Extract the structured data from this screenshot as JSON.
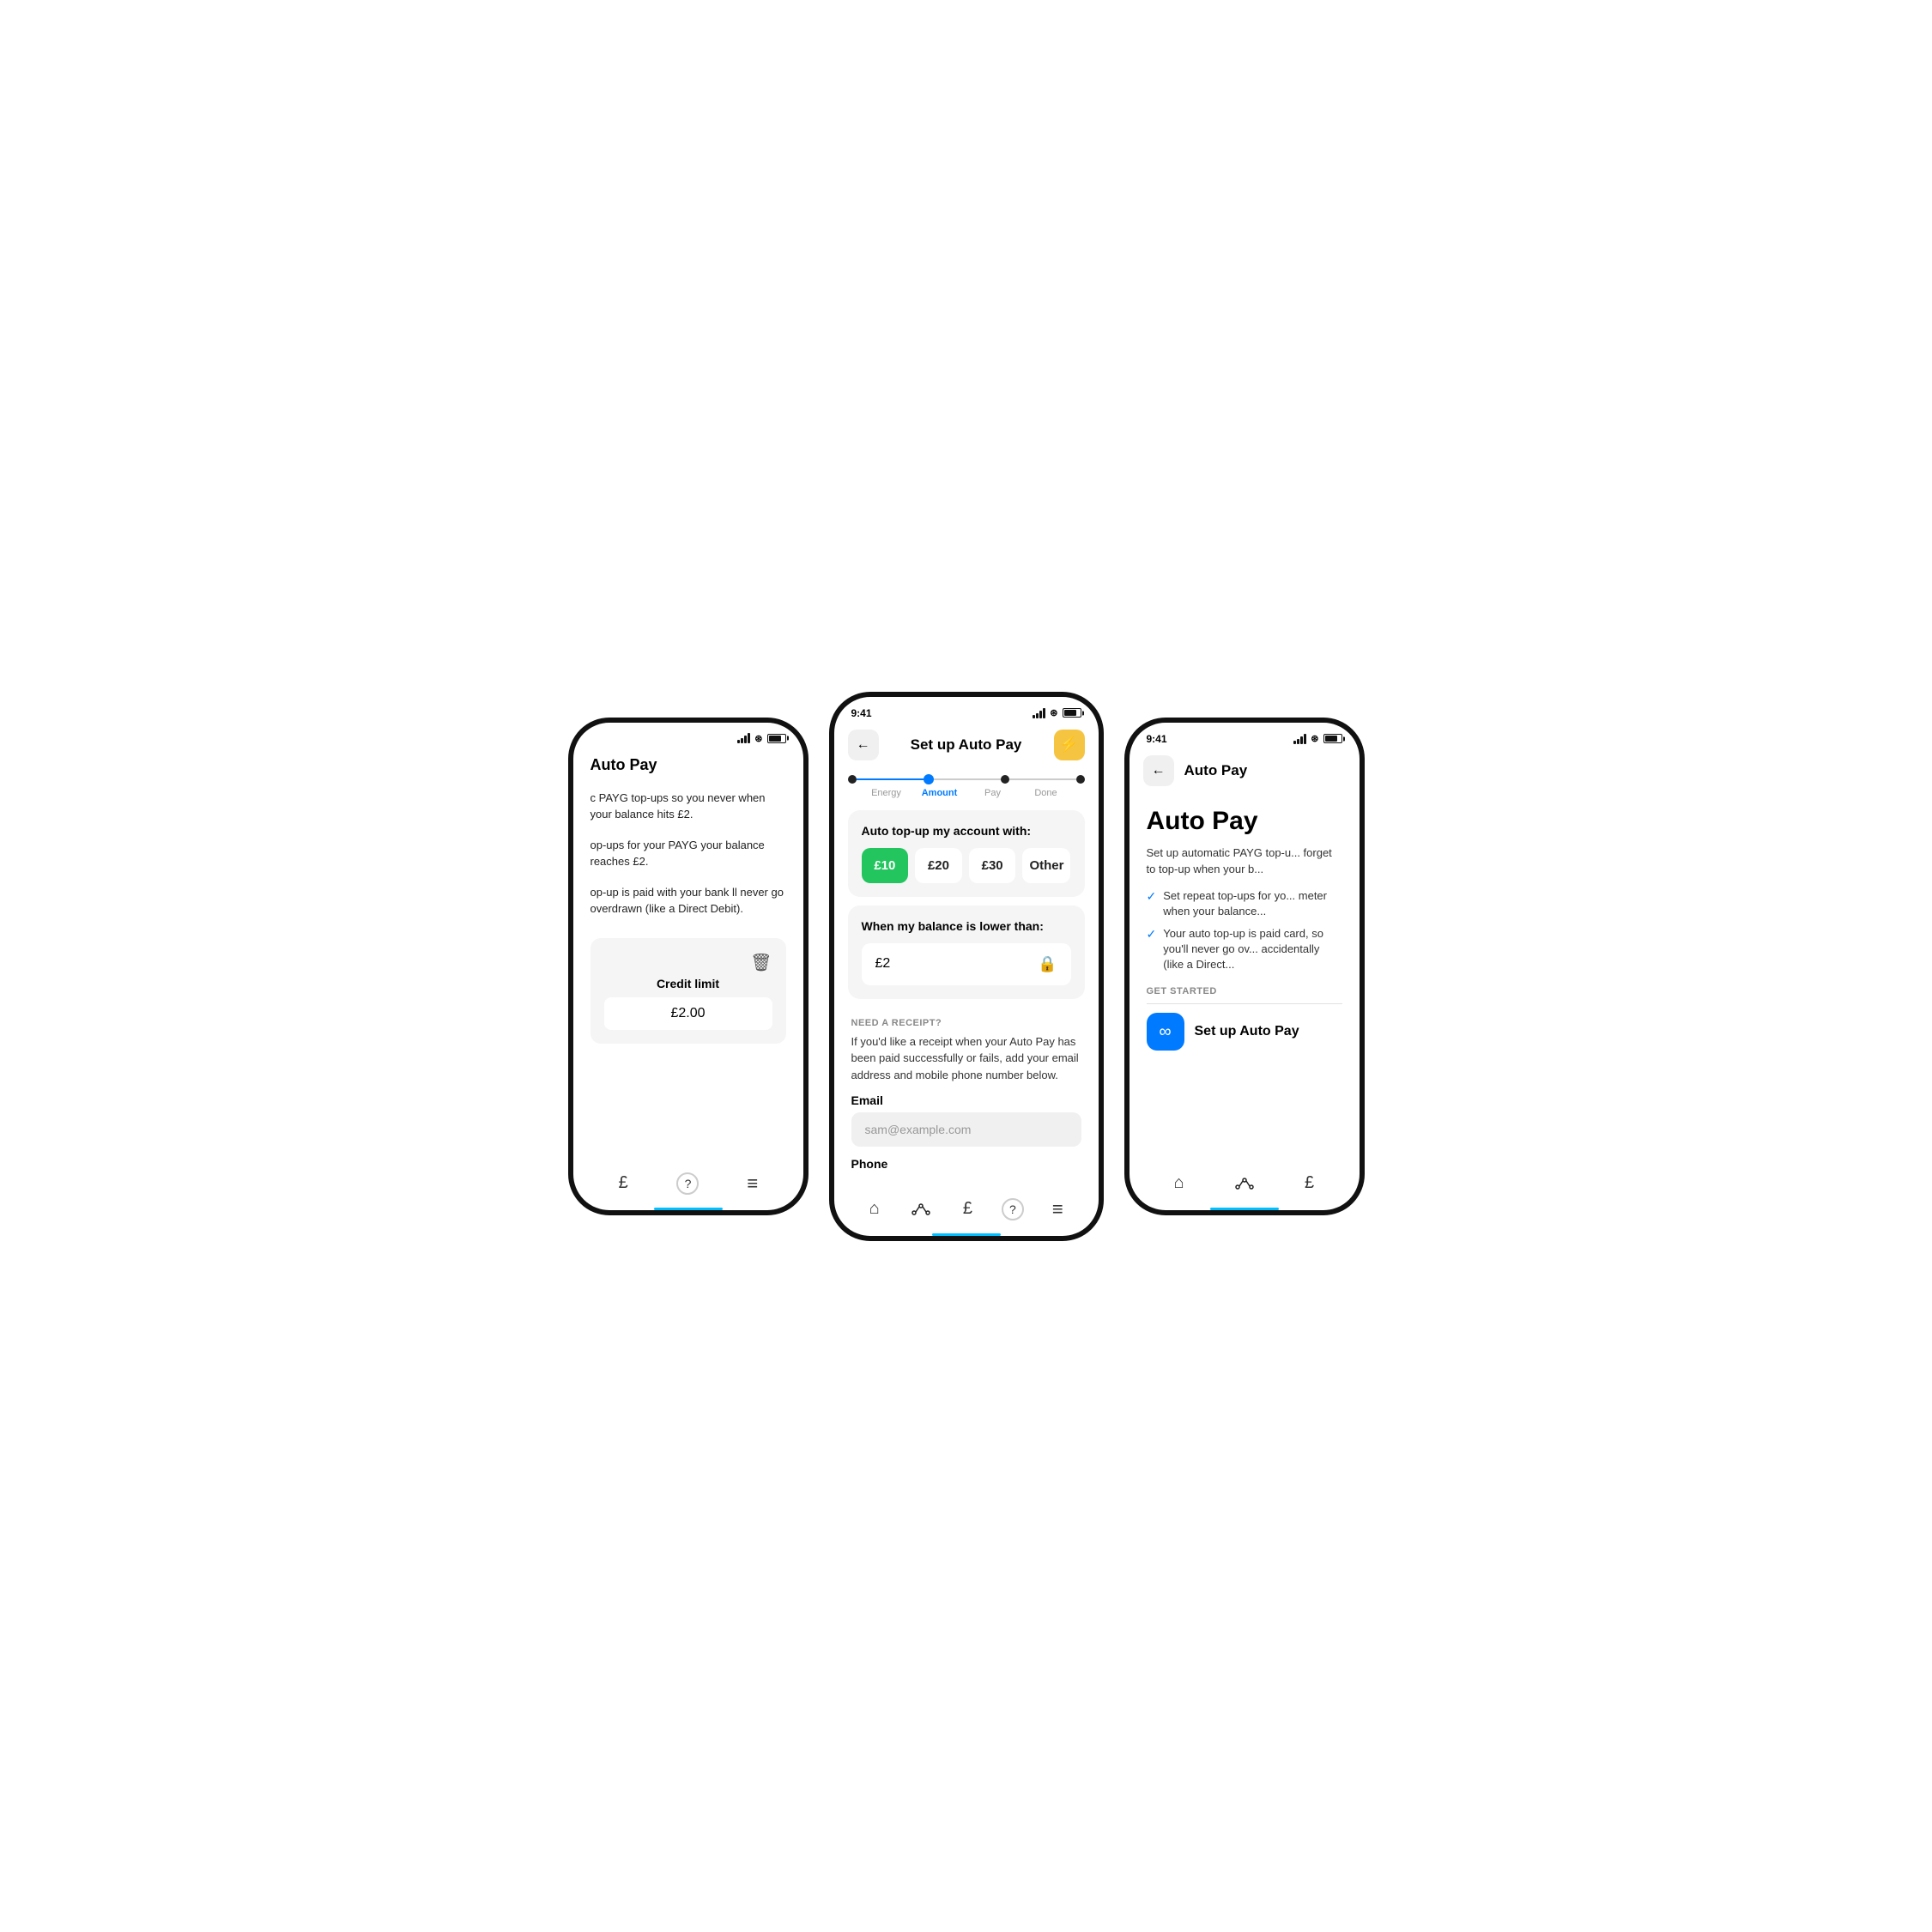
{
  "left_phone": {
    "title": "Auto Pay",
    "description1": "c PAYG top-ups so you never when your balance hits £2.",
    "description2": "op-ups for your PAYG your balance reaches £2.",
    "description3": "op-up is paid with your bank ll never go overdrawn (like a Direct Debit).",
    "credit_limit_label": "Credit limit",
    "credit_limit_value": "£2.00",
    "nav": {
      "items": [
        "£",
        "?",
        "≡"
      ]
    }
  },
  "center_phone": {
    "status_time": "9:41",
    "back_label": "←",
    "title": "Set up Auto Pay",
    "lightning_icon": "⚡",
    "steps": [
      {
        "label": "Energy",
        "active": false
      },
      {
        "label": "Amount",
        "active": true
      },
      {
        "label": "Pay",
        "active": false
      },
      {
        "label": "Done",
        "active": false
      }
    ],
    "amount_section": {
      "title": "Auto top-up my account with:",
      "options": [
        {
          "label": "£10",
          "selected": true
        },
        {
          "label": "£20",
          "selected": false
        },
        {
          "label": "£30",
          "selected": false
        },
        {
          "label": "Other",
          "selected": false
        }
      ]
    },
    "balance_section": {
      "title": "When my balance is lower than:",
      "value": "£2"
    },
    "receipt_section": {
      "label": "NEED A RECEIPT?",
      "description": "If you'd like a receipt when your Auto Pay has been paid successfully or fails, add your email address and mobile phone number below.",
      "email_label": "Email",
      "email_placeholder": "sam@example.com",
      "phone_label": "Phone"
    },
    "nav": {
      "items": [
        "⌂",
        "〰",
        "£",
        "?",
        "≡"
      ]
    }
  },
  "right_phone": {
    "status_time": "9:41",
    "back_label": "←",
    "title": "Auto Pay",
    "main_title": "Auto Pay",
    "description": "Set up automatic PAYG top-u... forget to top-up when your b...",
    "checks": [
      "Set repeat top-ups for yo... meter when your balance...",
      "Your auto top-up is paid card, so you'll never go ov... accidentally (like a Direct..."
    ],
    "get_started_label": "GET STARTED",
    "setup_btn_label": "Set up Auto Pay",
    "nav": {
      "items": [
        "⌂",
        "〰",
        "£"
      ]
    }
  }
}
